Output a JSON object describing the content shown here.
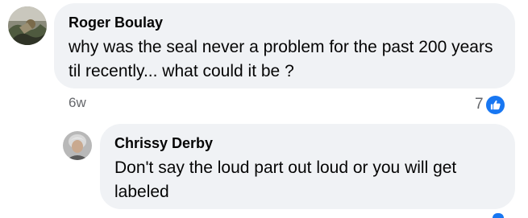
{
  "comments": [
    {
      "author": "Roger Boulay",
      "text": "why was the seal never a problem for the past 200 years til recently... what could it be ?",
      "time": "6w",
      "reaction_count": "7",
      "reaction_icon": "like-icon"
    },
    {
      "author": "Chrissy Derby",
      "text": "Don't say the loud part out loud or you will get labeled"
    }
  ],
  "colors": {
    "bubble": "#f0f2f5",
    "like_blue": "#1877f2",
    "meta_gray": "#65676b",
    "text": "#050505"
  }
}
